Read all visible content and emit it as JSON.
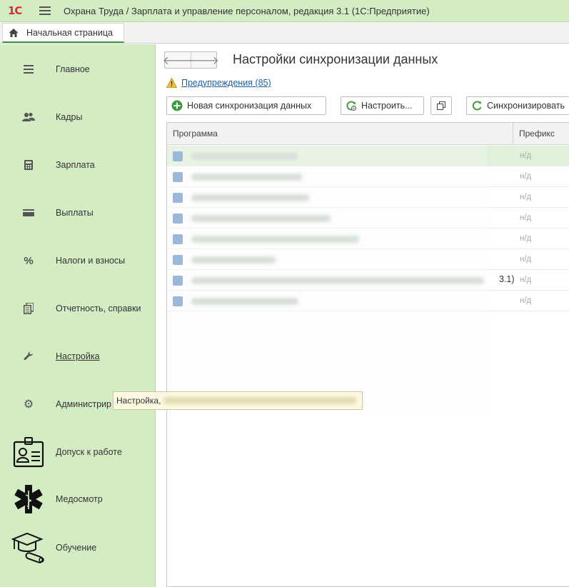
{
  "window": {
    "logo_text": "1С",
    "title": "Охрана Труда / Зарплата и управление персоналом, редакция 3.1  (1С:Предприятие)"
  },
  "tabs": {
    "home": "Начальная страница"
  },
  "sidebar": {
    "items": [
      {
        "label": "Главное",
        "icon": "menu-lines-icon"
      },
      {
        "label": "Кадры",
        "icon": "people-icon"
      },
      {
        "label": "Зарплата",
        "icon": "calculator-icon"
      },
      {
        "label": "Выплаты",
        "icon": "wallet-icon"
      },
      {
        "label": "Налоги и взносы",
        "icon": "percent-icon"
      },
      {
        "label": "Отчетность, справки",
        "icon": "documents-icon"
      },
      {
        "label": "Настройка",
        "icon": "wrench-icon",
        "active": true
      },
      {
        "label": "Администрир",
        "icon": "gear-icon"
      },
      {
        "label": "Допуск к работе",
        "icon": "badge-icon"
      },
      {
        "label": "Медосмотр",
        "icon": "medical-star-icon"
      },
      {
        "label": "Обучение",
        "icon": "graduation-cap-icon"
      }
    ]
  },
  "main": {
    "title": "Настройки синхронизации данных",
    "warnings_link": "Предупреждения (85)",
    "toolbar": {
      "new_sync": "Новая синхронизация данных",
      "configure": "Настроить...",
      "synchronize": "Синхронизировать"
    },
    "table": {
      "columns": {
        "program": "Программа",
        "prefix": "Префикс"
      },
      "rows": [
        {
          "name": "",
          "suffix": "",
          "prefix": "н/д",
          "selected": true
        },
        {
          "name": "",
          "suffix": "",
          "prefix": "н/д"
        },
        {
          "name": "",
          "suffix": "",
          "prefix": "н/д"
        },
        {
          "name": "",
          "suffix": "",
          "prefix": "н/д"
        },
        {
          "name": "",
          "suffix": "",
          "prefix": "н/д"
        },
        {
          "name": "",
          "suffix": "",
          "prefix": "н/д"
        },
        {
          "name": "",
          "suffix": "3.1)",
          "prefix": "н/д"
        },
        {
          "name": "",
          "suffix": "",
          "prefix": "н/д"
        }
      ]
    }
  },
  "tooltip": {
    "text": "Настройка,"
  },
  "colors": {
    "sidebar_bg": "#d4ecc4",
    "accent_green": "#3c9c3c",
    "link_blue": "#1a5fa8",
    "selected_row": "#dff1d9"
  }
}
